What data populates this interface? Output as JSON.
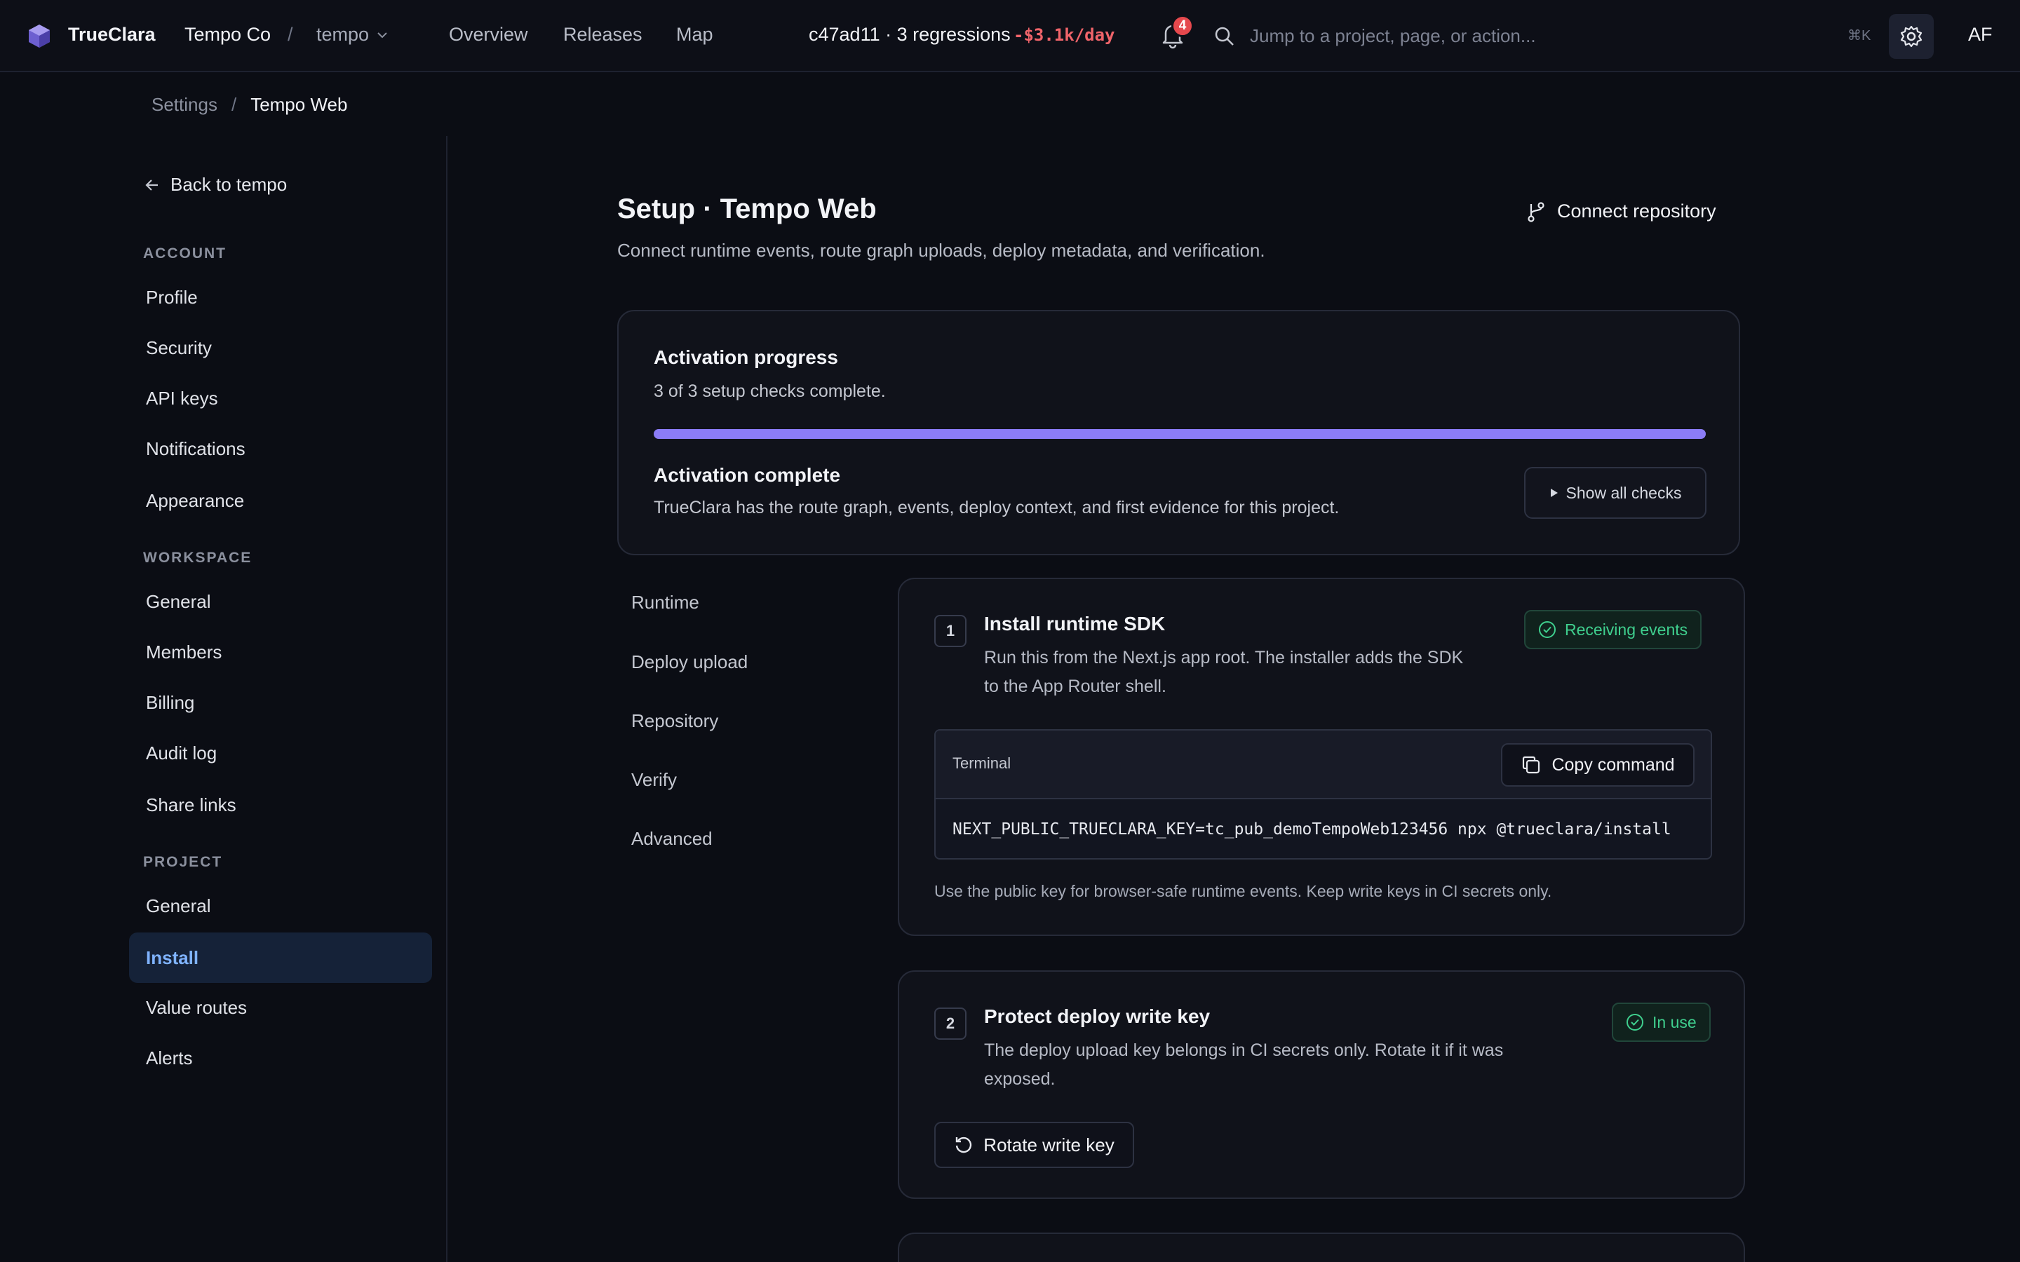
{
  "topbar": {
    "brand": "TrueClara",
    "org": "Tempo Co",
    "separator": "/",
    "project": "tempo",
    "nav": [
      "Overview",
      "Releases",
      "Map"
    ],
    "commit_status": "c47ad11 · 3 regressions",
    "cost_delta": "-$3.1k/day",
    "notification_count": "4",
    "search_placeholder": "Jump to a project, page, or action...",
    "shortcut": "⌘K",
    "avatar_initials": "AF",
    "accent_color": "#8b7cf6"
  },
  "breadcrumb": {
    "parent": "Settings",
    "separator": "/",
    "current": "Tempo Web"
  },
  "sidebar": {
    "back_label": "Back to tempo",
    "sections": [
      {
        "heading": "ACCOUNT",
        "items": [
          "Profile",
          "Security",
          "API keys",
          "Notifications",
          "Appearance"
        ]
      },
      {
        "heading": "WORKSPACE",
        "items": [
          "General",
          "Members",
          "Billing",
          "Audit log",
          "Share links"
        ]
      },
      {
        "heading": "PROJECT",
        "items": [
          "General",
          "Install",
          "Value routes",
          "Alerts"
        ]
      }
    ],
    "active_item": "Install"
  },
  "page": {
    "title": "Setup · Tempo Web",
    "subtitle": "Connect runtime events, route graph uploads, deploy metadata, and verification.",
    "connect_label": "Connect repository"
  },
  "activation": {
    "title": "Activation progress",
    "status": "3 of 3 setup checks complete.",
    "progress_fraction": 1.0,
    "complete_title": "Activation complete",
    "complete_desc": "TrueClara has the route graph, events, deploy context, and first evidence for this project.",
    "show_checks_label": "Show all checks"
  },
  "subnav": [
    "Runtime",
    "Deploy upload",
    "Repository",
    "Verify",
    "Advanced"
  ],
  "steps": [
    {
      "number": "1",
      "title": "Install runtime SDK",
      "desc_line1": "Run this from the Next.js app root. The installer adds the SDK",
      "desc_line2": "to the App Router shell.",
      "status": "Receiving events",
      "terminal_label": "Terminal",
      "copy_label": "Copy command",
      "command": "NEXT_PUBLIC_TRUECLARA_KEY=tc_pub_demoTempoWeb123456 npx @trueclara/install",
      "hint": "Use the public key for browser-safe runtime events. Keep write keys in CI secrets only."
    },
    {
      "number": "2",
      "title": "Protect deploy write key",
      "desc_line1": "The deploy upload key belongs in CI secrets only. Rotate it if it was",
      "desc_line2": "exposed.",
      "status": "In use",
      "action_label": "Rotate write key"
    }
  ]
}
